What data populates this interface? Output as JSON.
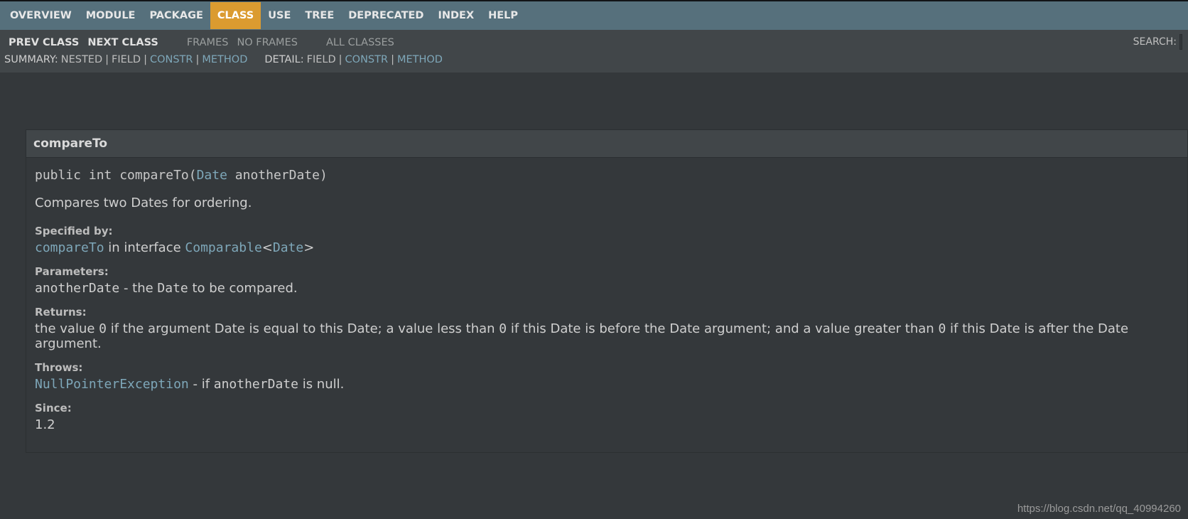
{
  "topnav": {
    "items": [
      "OVERVIEW",
      "MODULE",
      "PACKAGE",
      "CLASS",
      "USE",
      "TREE",
      "DEPRECATED",
      "INDEX",
      "HELP"
    ],
    "active_index": 3
  },
  "subnav": {
    "prev": "PREV CLASS",
    "next": "NEXT CLASS",
    "frames": "FRAMES",
    "noframes": "NO FRAMES",
    "allclasses": "ALL CLASSES",
    "search_label": "SEARCH:",
    "summary_label": "SUMMARY:",
    "summary": {
      "nested": "NESTED",
      "field": "FIELD",
      "constr": "CONSTR",
      "method": "METHOD"
    },
    "detail_label": "DETAIL:",
    "detail": {
      "field": "FIELD",
      "constr": "CONSTR",
      "method": "METHOD"
    }
  },
  "method": {
    "name": "compareTo",
    "signature": {
      "prefix": "public int compareTo(",
      "param_type": "Date",
      "param_name": " anotherDate",
      "suffix": ")"
    },
    "description": "Compares two Dates for ordering.",
    "specified_by_label": "Specified by:",
    "specified_by": {
      "method": "compareTo",
      "mid": " in interface ",
      "iface": "Comparable",
      "lt": "<",
      "type": "Date",
      "gt": ">"
    },
    "parameters_label": "Parameters:",
    "parameters": {
      "name": "anotherDate",
      "sep": " - the ",
      "code": "Date",
      "tail": " to be compared."
    },
    "returns_label": "Returns:",
    "returns": {
      "p1": "the value ",
      "c1": "0",
      "p2": " if the argument Date is equal to this Date; a value less than ",
      "c2": "0",
      "p3": " if this Date is before the Date argument; and a value greater than ",
      "c3": "0",
      "p4": " if this Date is after the Date argument."
    },
    "throws_label": "Throws:",
    "throws": {
      "exception": "NullPointerException",
      "sep": " - if ",
      "code": "anotherDate",
      "tail": " is null."
    },
    "since_label": "Since:",
    "since": "1.2"
  },
  "watermark": "https://blog.csdn.net/qq_40994260"
}
